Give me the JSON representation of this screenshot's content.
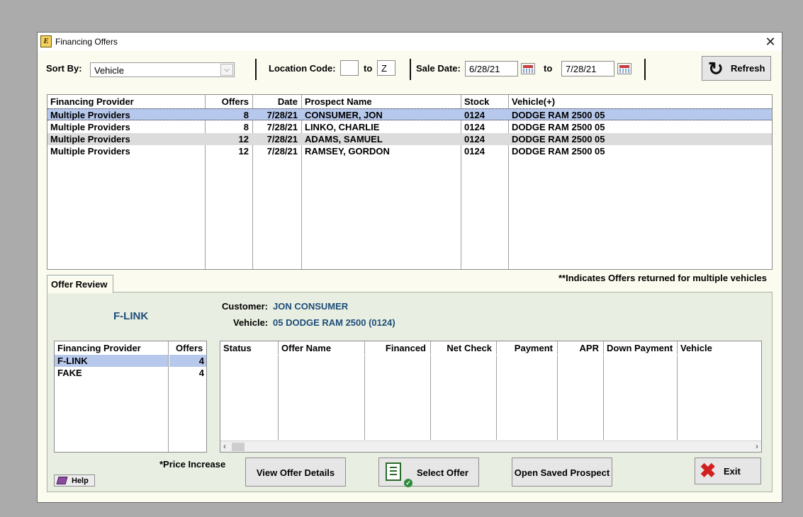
{
  "window": {
    "title": "Financing Offers",
    "close_glyph": "✕"
  },
  "filters": {
    "sort_by_label": "Sort By:",
    "sort_by_value": "Vehicle",
    "location_code_label": "Location Code:",
    "location_from": "",
    "location_to_label": "to",
    "location_to": "Z",
    "sale_date_label": "Sale Date:",
    "sale_date_from": "6/28/21",
    "sale_date_to_label": "to",
    "sale_date_to": "7/28/21",
    "refresh_label": "Refresh"
  },
  "offers_table": {
    "headers": [
      "Financing Provider",
      "Offers",
      "Date",
      "Prospect Name",
      "Stock",
      "Vehicle(+)"
    ],
    "rows": [
      [
        "Multiple Providers",
        "8",
        "7/28/21",
        "CONSUMER, JON",
        "0124",
        "DODGE RAM 2500 05"
      ],
      [
        "Multiple Providers",
        "8",
        "7/28/21",
        "LINKO, CHARLIE",
        "0124",
        "DODGE RAM 2500 05"
      ],
      [
        "Multiple Providers",
        "12",
        "7/28/21",
        "ADAMS, SAMUEL",
        "0124",
        "DODGE RAM 2500 05"
      ],
      [
        "Multiple Providers",
        "12",
        "7/28/21",
        "RAMSEY, GORDON",
        "0124",
        "DODGE RAM 2500 05"
      ]
    ]
  },
  "note": "**Indicates Offers returned for multiple vehicles",
  "review": {
    "tab_label": "Offer Review",
    "provider_name": "F-LINK",
    "customer_label": "Customer:",
    "customer_value": "JON CONSUMER",
    "vehicle_label": "Vehicle:",
    "vehicle_value": "05 DODGE RAM 2500 (0124)",
    "providers_headers": [
      "Financing Provider",
      "Offers"
    ],
    "providers": [
      [
        "F-LINK",
        "4"
      ],
      [
        "FAKE",
        "4"
      ]
    ],
    "details_headers": [
      "Status",
      "Offer Name",
      "Financed",
      "Net Check",
      "Payment",
      "APR",
      "Down Payment",
      "Vehicle"
    ],
    "price_increase_note": "*Price Increase"
  },
  "buttons": {
    "help": "Help",
    "view_offer_details": "View Offer Details",
    "select_offer": "Select Offer",
    "open_saved_prospect": "Open Saved Prospect",
    "exit": "Exit"
  },
  "colors": {
    "window_bg": "#fbfbef",
    "panel_bg": "#e8eee1",
    "selected_row": "#b6c8ec",
    "accent_blue": "#1e4d7a"
  }
}
